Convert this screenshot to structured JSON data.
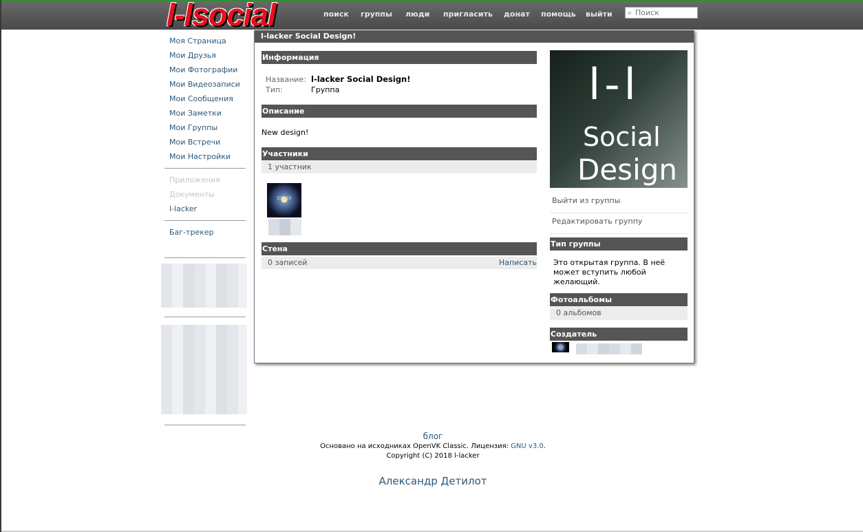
{
  "brand": {
    "logo_text": "l-lsocial"
  },
  "topnav": [
    "поиск",
    "группы",
    "люди",
    "пригласить",
    "донат",
    "помощь",
    "выйти"
  ],
  "search": {
    "placeholder": "Поиск"
  },
  "leftnav": {
    "items": [
      "Моя Страница",
      "Мои Друзья",
      "Мои Фотографии",
      "Мои Видеозаписи",
      "Мои Сообщения",
      "Мои Заметки",
      "Мои Группы",
      "Мои Встречи",
      "Мои Настройки"
    ],
    "extra": [
      "Приложения",
      "Документы",
      "l-lacker"
    ],
    "bugtracker": "Баг-трекер"
  },
  "group": {
    "page_title": "l-lacker Social Design!",
    "info_header": "Информация",
    "name_label": "Название:",
    "name_value": "l-lacker Social Design!",
    "type_label": "Тип:",
    "type_value": "Группа",
    "description_header": "Описание",
    "description_text": "New design!",
    "members_header": "Участники",
    "members_count": "1 участник",
    "wall_header": "Стена",
    "wall_count": "0 записей",
    "wall_write": "Написать",
    "photo": {
      "line1": "l-l",
      "line2": "Social",
      "line3": "Design"
    },
    "leave_link": "Выйти из группы",
    "edit_link": "Редактировать группу",
    "type_header": "Тип группы",
    "type_description": "Это открытая группа. В неё может вступить любой желающий.",
    "albums_header": "Фотоальбомы",
    "albums_count": "0 альбомов",
    "creator_header": "Создатель"
  },
  "footer": {
    "blog": "блог",
    "based_on": "Основано на исходниках OpenVK Classic. Лицензия: ",
    "license": "GNU v3.0",
    "license_suffix": ".",
    "copyright": "Copyright (C) 2018 l-lacker",
    "author": "Александр Детилот"
  }
}
